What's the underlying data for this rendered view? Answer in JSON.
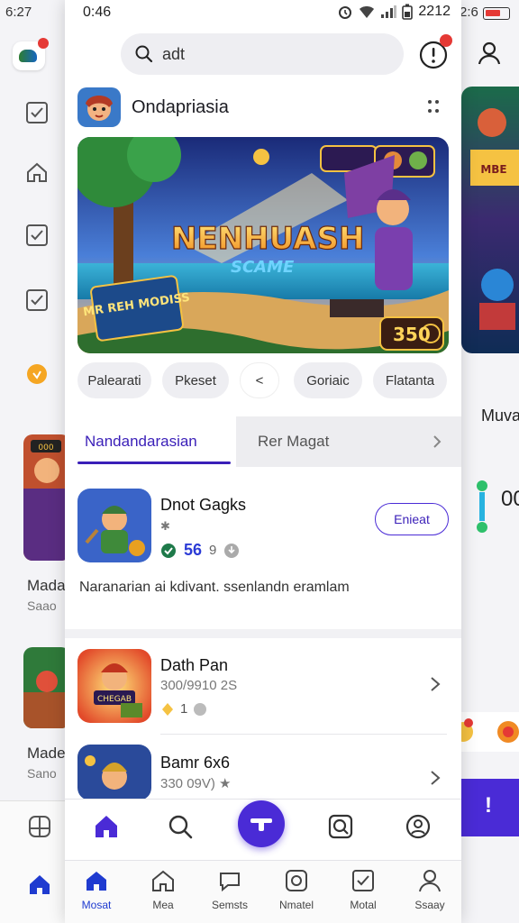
{
  "background_left": {
    "status_time": "6:27",
    "items": [
      {
        "title": "Mada",
        "subtitle": "Saao"
      },
      {
        "title": "Made",
        "subtitle": "Sano"
      }
    ]
  },
  "background_right": {
    "status_time": "2:6",
    "label": "Muva",
    "number": "00",
    "fab_label": "!"
  },
  "status": {
    "time": "0:46",
    "right_text": "2212"
  },
  "search": {
    "value": "adt"
  },
  "app": {
    "title": "Ondapriasia"
  },
  "banner": {
    "headline": "NENHUASH",
    "subheadline": "SCAME",
    "badge": "MR REH MODISS",
    "score": "350"
  },
  "chips": [
    "Palearati",
    "Pkeset",
    "<",
    "Goriaic",
    "Flatanta"
  ],
  "tabs": {
    "active": "Nandandarasian",
    "inactive": "Rer Magat"
  },
  "featured": {
    "title": "Dnot Gagks",
    "rating": "56",
    "rating_count": "9",
    "install_label": "Enieat",
    "description": "Naranarian ai kdivant. ssenlandn eramlam"
  },
  "list": [
    {
      "title": "Dath Pan",
      "meta": "300/9910 2S",
      "score": "1"
    },
    {
      "title": "Bamr 6x6",
      "meta": "330 09V) ★"
    }
  ],
  "nav_bottom": [
    "Mosat",
    "Mea",
    "Semsts",
    "Nmatel",
    "Motal",
    "Ssaay"
  ],
  "colors": {
    "accent": "#4a2bd6",
    "accent_text": "#3a1fb8",
    "notification": "#e53935"
  }
}
